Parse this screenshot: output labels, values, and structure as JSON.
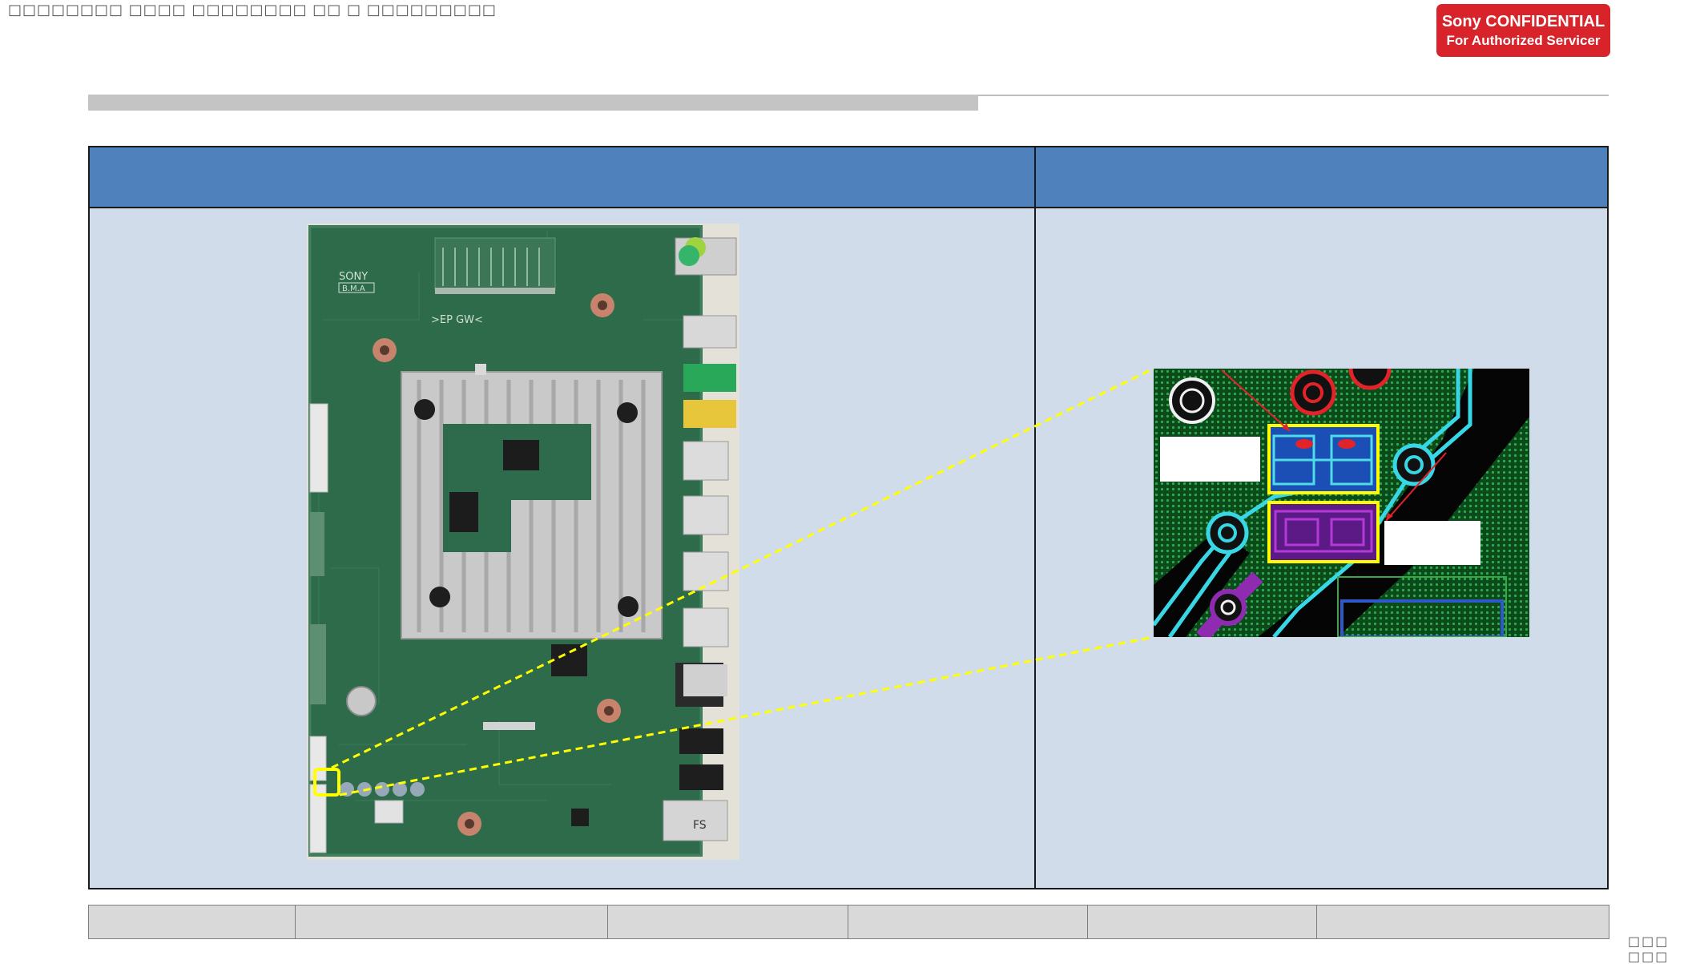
{
  "header": {
    "garbled_title": "□□□□□□□□ □□□□ □□□□□□□□ □□ □ □□□□□□□□□",
    "confidential_line1": "Sony CONFIDENTIAL",
    "confidential_line2": "For Authorized Servicer"
  },
  "colors": {
    "badge": "#d9232a",
    "table_header": "#4f81bd",
    "table_body": "#d1dcea",
    "highlight": "#ffff00"
  },
  "board": {
    "brand_text": "SONY",
    "marking": "B.M.A",
    "logo_text": ">EP GW<",
    "connector_label": "FS"
  },
  "footer": {
    "page_number": "□□□ □□□"
  }
}
